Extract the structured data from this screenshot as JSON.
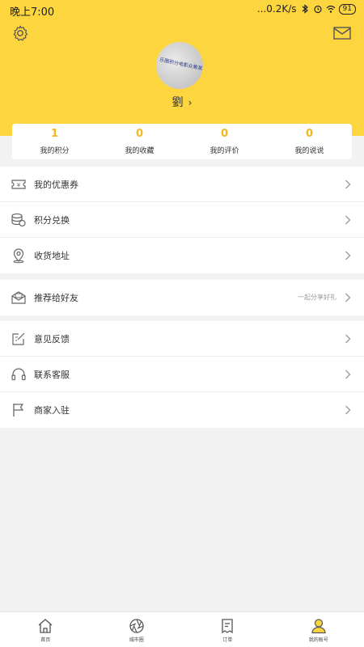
{
  "status": {
    "time": "晚上7:00",
    "speed": "...0.2K/s",
    "battery": "91"
  },
  "profile": {
    "avatar_text": "乐圈积分电影众筹某",
    "username": "劉",
    "chevron": "›"
  },
  "stats": [
    {
      "value": "1",
      "label": "我的积分"
    },
    {
      "value": "0",
      "label": "我的收藏"
    },
    {
      "value": "0",
      "label": "我的评价"
    },
    {
      "value": "0",
      "label": "我的说说"
    }
  ],
  "menu": {
    "group1": [
      {
        "label": "我的优惠券",
        "icon": "coupon-icon"
      },
      {
        "label": "积分兑换",
        "icon": "coins-icon"
      },
      {
        "label": "收货地址",
        "icon": "location-pin-icon"
      }
    ],
    "group2": [
      {
        "label": "推荐给好友",
        "icon": "share-envelope-icon",
        "hint": "一起分享好礼"
      }
    ],
    "group3": [
      {
        "label": "意见反馈",
        "icon": "feedback-icon"
      },
      {
        "label": "联系客服",
        "icon": "headset-icon"
      },
      {
        "label": "商家入驻",
        "icon": "flag-icon"
      }
    ]
  },
  "tabs": [
    {
      "label": "首页",
      "icon": "home-icon"
    },
    {
      "label": "城市圈",
      "icon": "aperture-icon"
    },
    {
      "label": "订单",
      "icon": "order-list-icon"
    },
    {
      "label": "我的账号",
      "icon": "user-icon",
      "active": true
    }
  ],
  "colors": {
    "brand_yellow": "#fdd53e",
    "stat_value": "#f2b821",
    "background": "#f2f2f2"
  }
}
